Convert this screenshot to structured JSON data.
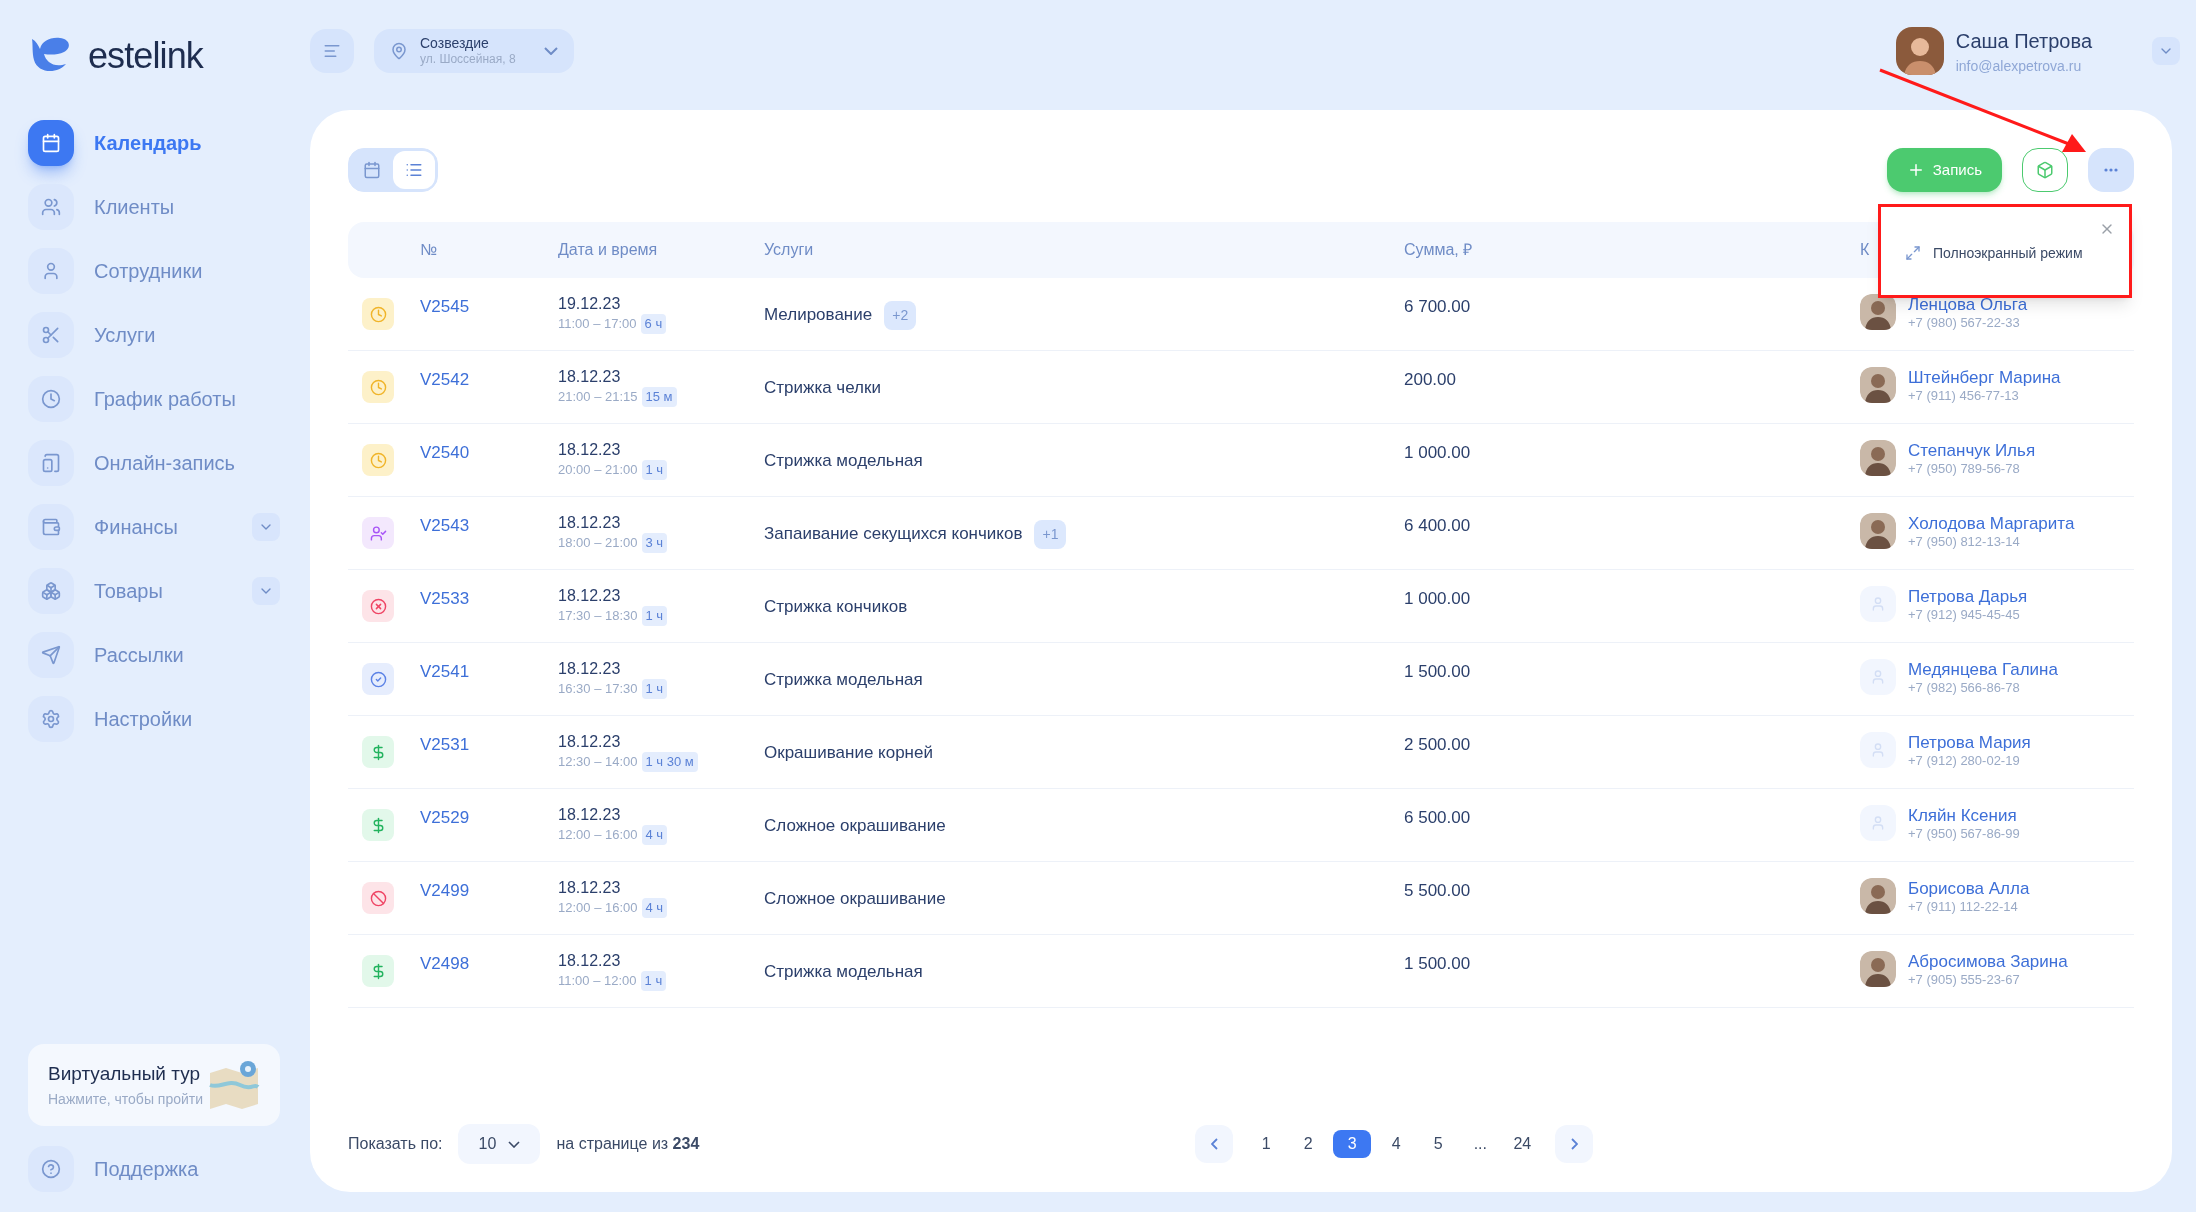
{
  "logo": {
    "text": "estelink"
  },
  "topbar": {
    "location": {
      "name": "Созвездие",
      "address": "ул. Шоссейная, 8"
    },
    "user": {
      "name": "Саша Петрова",
      "email": "info@alexpetrova.ru"
    }
  },
  "sidebar": {
    "items": [
      {
        "label": "Календарь",
        "selected": true,
        "has_submenu": false
      },
      {
        "label": "Клиенты",
        "selected": false,
        "has_submenu": false
      },
      {
        "label": "Сотрудники",
        "selected": false,
        "has_submenu": false
      },
      {
        "label": "Услуги",
        "selected": false,
        "has_submenu": false
      },
      {
        "label": "График работы",
        "selected": false,
        "has_submenu": false
      },
      {
        "label": "Онлайн-запись",
        "selected": false,
        "has_submenu": false
      },
      {
        "label": "Финансы",
        "selected": false,
        "has_submenu": true
      },
      {
        "label": "Товары",
        "selected": false,
        "has_submenu": true
      },
      {
        "label": "Рассылки",
        "selected": false,
        "has_submenu": false
      },
      {
        "label": "Настройки",
        "selected": false,
        "has_submenu": false
      }
    ],
    "tour": {
      "title": "Виртуальный тур",
      "subtitle": "Нажмите, чтобы пройти"
    },
    "support": "Поддержка"
  },
  "view_toggle": [
    {
      "kind": "calendar",
      "selected": false
    },
    {
      "kind": "list",
      "selected": true
    }
  ],
  "actions": {
    "add_button": "Запись",
    "menu_popup": {
      "item": "Полноэкранный режим"
    }
  },
  "table": {
    "columns": [
      "№",
      "Дата и время",
      "Услуги",
      "Сумма, ₽",
      "К"
    ],
    "rows": [
      {
        "kind": "pending",
        "number": "V2545",
        "date": "19.12.23",
        "time": "11:00 – 17:00",
        "duration": "6 ч",
        "service": "Мелирование",
        "extra": "+2",
        "sum": "6 700.00",
        "client": "Ленцова Ольга",
        "phone": "+7 (980) 567-22-33",
        "photo": true
      },
      {
        "kind": "pending",
        "number": "V2542",
        "date": "18.12.23",
        "time": "21:00 – 21:15",
        "duration": "15 м",
        "service": "Стрижка челки",
        "sum": "200.00",
        "client": "Штейнберг Марина",
        "phone": "+7 (911) 456-77-13",
        "photo": true
      },
      {
        "kind": "pending",
        "number": "V2540",
        "date": "18.12.23",
        "time": "20:00 – 21:00",
        "duration": "1 ч",
        "service": "Стрижка модельная",
        "sum": "1 000.00",
        "client": "Степанчук Илья",
        "phone": "+7 (950) 789-56-78",
        "photo": true
      },
      {
        "kind": "arrived",
        "number": "V2543",
        "date": "18.12.23",
        "time": "18:00 – 21:00",
        "duration": "3 ч",
        "service": "Запаивание секущихся кончиков",
        "extra": "+1",
        "sum": "6 400.00",
        "client": "Холодова Маргарита",
        "phone": "+7 (950) 812-13-14",
        "photo": true
      },
      {
        "kind": "cancelled",
        "number": "V2533",
        "date": "18.12.23",
        "time": "17:30 – 18:30",
        "duration": "1 ч",
        "service": "Стрижка кончиков",
        "sum": "1 000.00",
        "client": "Петрова Дарья",
        "phone": "+7 (912) 945-45-45",
        "photo": false
      },
      {
        "kind": "confirmed",
        "number": "V2541",
        "date": "18.12.23",
        "time": "16:30 – 17:30",
        "duration": "1 ч",
        "service": "Стрижка модельная",
        "sum": "1 500.00",
        "client": "Медянцева Галина",
        "phone": "+7 (982) 566-86-78",
        "photo": false
      },
      {
        "kind": "paid",
        "number": "V2531",
        "date": "18.12.23",
        "time": "12:30 – 14:00",
        "duration": "1 ч 30 м",
        "service": "Окрашивание корней",
        "sum": "2 500.00",
        "client": "Петрова Мария",
        "phone": "+7 (912) 280-02-19",
        "photo": false
      },
      {
        "kind": "paid",
        "number": "V2529",
        "date": "18.12.23",
        "time": "12:00 – 16:00",
        "duration": "4 ч",
        "service": "Сложное окрашивание",
        "sum": "6 500.00",
        "client": "Кляйн Ксения",
        "phone": "+7 (950) 567-86-99",
        "photo": false
      },
      {
        "kind": "noshow",
        "number": "V2499",
        "date": "18.12.23",
        "time": "12:00 – 16:00",
        "duration": "4 ч",
        "service": "Сложное окрашивание",
        "sum": "5 500.00",
        "client": "Борисова Алла",
        "phone": "+7 (911) 112-22-14",
        "photo": true
      },
      {
        "kind": "paid",
        "number": "V2498",
        "date": "18.12.23",
        "time": "11:00 – 12:00",
        "duration": "1 ч",
        "service": "Стрижка модельная",
        "sum": "1 500.00",
        "client": "Абросимова Зарина",
        "phone": "+7 (905) 555-23-67",
        "photo": true
      }
    ]
  },
  "footer": {
    "show_label": "Показать по:",
    "page_size": "10",
    "total_text": "на странице из **234**",
    "pages": [
      {
        "label": "1",
        "selected": false
      },
      {
        "label": "2",
        "selected": false
      },
      {
        "label": "3",
        "selected": true
      },
      {
        "label": "4",
        "selected": false
      },
      {
        "label": "5",
        "selected": false
      },
      {
        "label": "...",
        "selected": false
      },
      {
        "label": "24",
        "selected": false
      }
    ]
  }
}
